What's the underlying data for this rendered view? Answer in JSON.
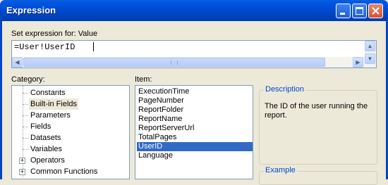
{
  "window": {
    "title": "Expression"
  },
  "expression": {
    "label": "Set expression for: Value",
    "value": "=User!UserID"
  },
  "category": {
    "label": "Category:",
    "items": [
      {
        "label": "Constants"
      },
      {
        "label": "Built-in Fields"
      },
      {
        "label": "Parameters"
      },
      {
        "label": "Fields"
      },
      {
        "label": "Datasets"
      },
      {
        "label": "Variables"
      },
      {
        "label": "Operators"
      },
      {
        "label": "Common Functions"
      }
    ],
    "selected": "Built-in Fields"
  },
  "item": {
    "label": "Item:",
    "items": [
      {
        "label": "ExecutionTime"
      },
      {
        "label": "PageNumber"
      },
      {
        "label": "ReportFolder"
      },
      {
        "label": "ReportName"
      },
      {
        "label": "ReportServerUrl"
      },
      {
        "label": "TotalPages"
      },
      {
        "label": "UserID"
      },
      {
        "label": "Language"
      }
    ],
    "selected": "UserID"
  },
  "description": {
    "title": "Description",
    "text": "The ID of the user running the report."
  },
  "example": {
    "title": "Example"
  }
}
